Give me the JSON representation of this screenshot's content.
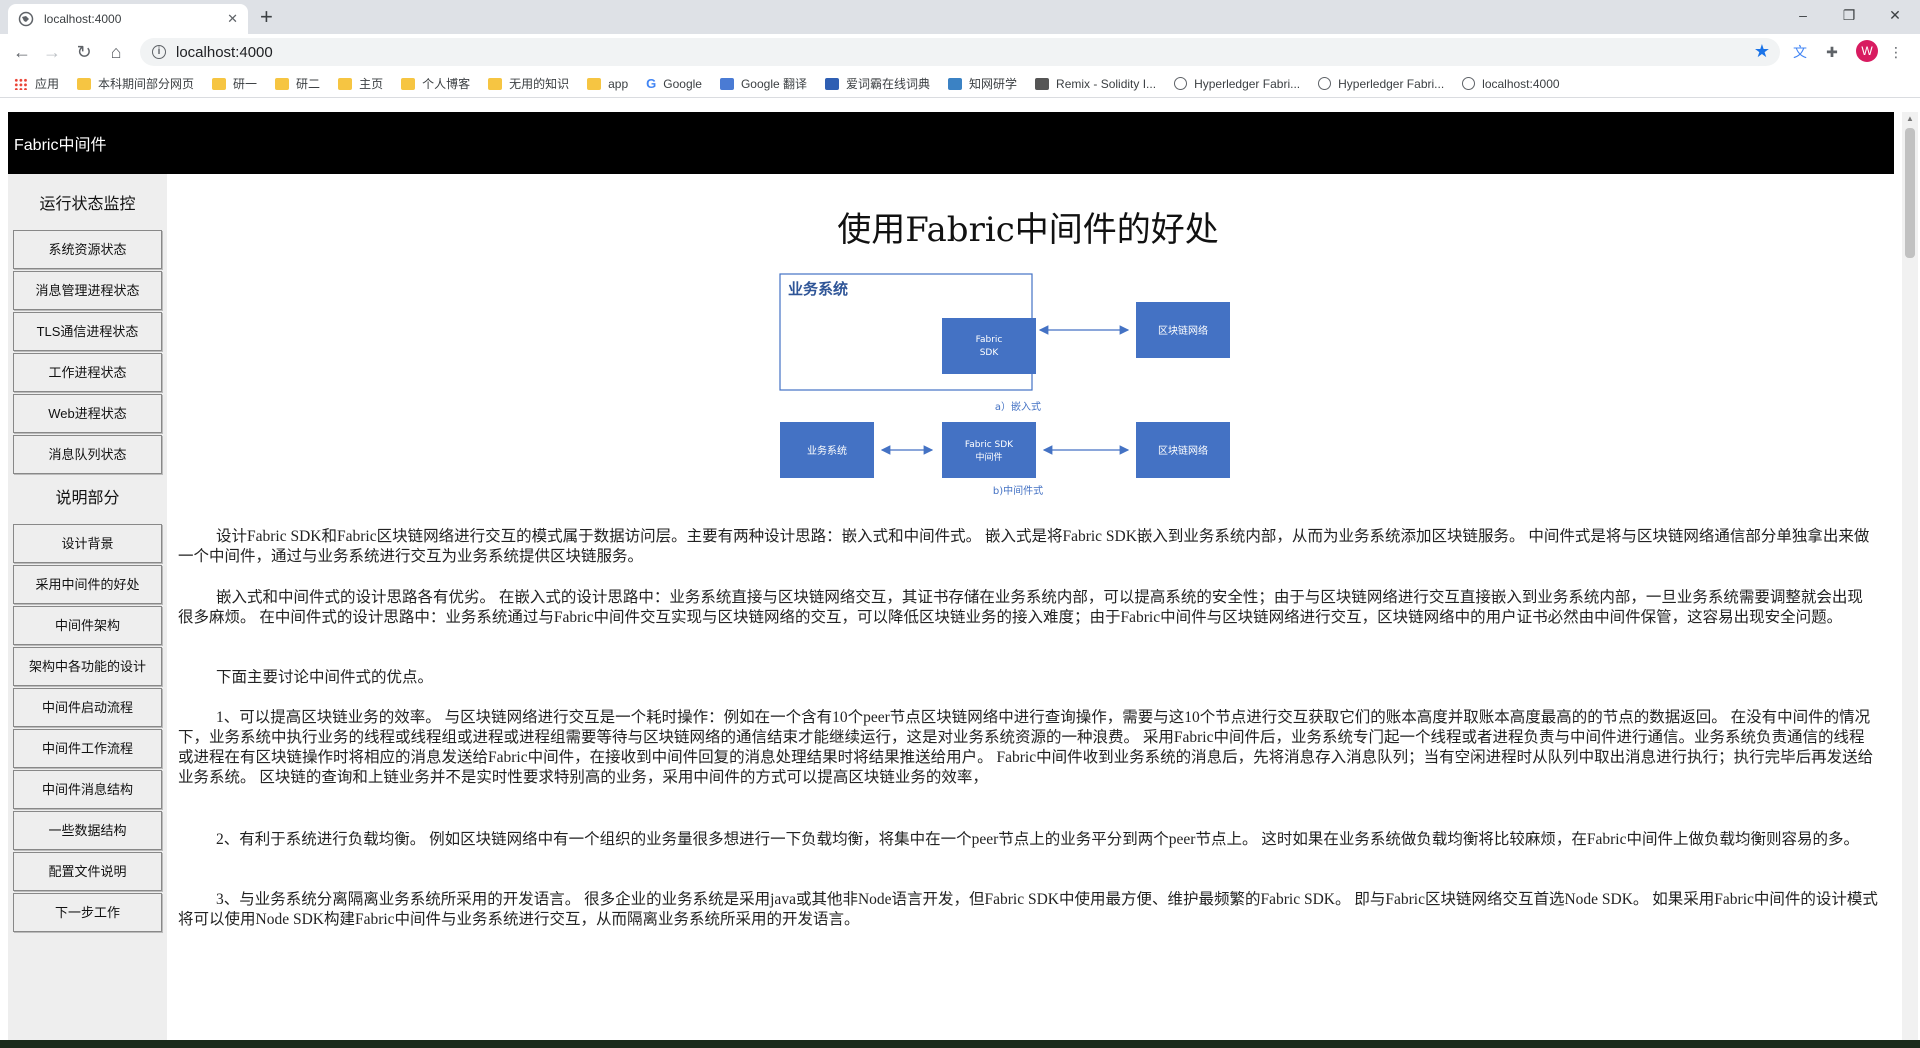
{
  "browser": {
    "tab_title": "localhost:4000",
    "tab_close": "✕",
    "new_tab": "+",
    "address": "localhost:4000",
    "window_controls": [
      "–",
      "❐",
      "✕"
    ],
    "avatar_letter": "W",
    "bookmarks": [
      {
        "label": "应用",
        "icon": "apps-icon"
      },
      {
        "label": "本科期间部分网页",
        "icon": "folder-icon"
      },
      {
        "label": "研一",
        "icon": "folder-icon"
      },
      {
        "label": "研二",
        "icon": "folder-icon"
      },
      {
        "label": "主页",
        "icon": "folder-icon"
      },
      {
        "label": "个人博客",
        "icon": "folder-icon"
      },
      {
        "label": "无用的知识",
        "icon": "folder-icon"
      },
      {
        "label": "app",
        "icon": "folder-icon"
      },
      {
        "label": "Google",
        "icon": "google-icon"
      },
      {
        "label": "Google 翻译",
        "icon": "translate-icon"
      },
      {
        "label": "爱词霸在线词典",
        "icon": "dictionary-icon"
      },
      {
        "label": "知网研学",
        "icon": "cnki-icon"
      },
      {
        "label": "Remix - Solidity I...",
        "icon": "remix-icon"
      },
      {
        "label": "Hyperledger Fabri...",
        "icon": "globe-icon"
      },
      {
        "label": "Hyperledger Fabri...",
        "icon": "globe-icon"
      },
      {
        "label": "localhost:4000",
        "icon": "globe-icon"
      }
    ]
  },
  "header": {
    "title": "Fabric中间件"
  },
  "sidebar": {
    "section1_title": "运行状态监控",
    "section1_items": [
      "系统资源状态",
      "消息管理进程状态",
      "TLS通信进程状态",
      "工作进程状态",
      "Web进程状态",
      "消息队列状态"
    ],
    "section2_title": "说明部分",
    "section2_items": [
      "设计背景",
      "采用中间件的好处",
      "中间件架构",
      "架构中各功能的设计",
      "中间件启动流程",
      "中间件工作流程",
      "中间件消息结构",
      "一些数据结构",
      "配置文件说明",
      "下一步工作"
    ]
  },
  "main": {
    "title": "使用Fabric中间件的好处",
    "diagram": {
      "business_system_title": "业务系统",
      "fabric_sdk_line1": "Fabric",
      "fabric_sdk_line2": "SDK",
      "blockchain_a": "区块链网络",
      "caption_a": "a）嵌入式",
      "business_system_b": "业务系统",
      "middleware_line1": "Fabric SDK",
      "middleware_line2": "中间件",
      "blockchain_b": "区块链网络",
      "caption_b": "b)中间件式",
      "box_color": "#4472c4"
    },
    "paragraphs": [
      "设计Fabric SDK和Fabric区块链网络进行交互的模式属于数据访问层。主要有两种设计思路：嵌入式和中间件式。 嵌入式是将Fabric SDK嵌入到业务系统内部，从而为业务系统添加区块链服务。 中间件式是将与区块链网络通信部分单独拿出来做一个中间件，通过与业务系统进行交互为业务系统提供区块链服务。",
      "嵌入式和中间件式的设计思路各有优劣。 在嵌入式的设计思路中：业务系统直接与区块链网络交互，其证书存储在业务系统内部，可以提高系统的安全性；由于与区块链网络进行交互直接嵌入到业务系统内部，一旦业务系统需要调整就会出现很多麻烦。 在中间件式的设计思路中：业务系统通过与Fabric中间件交互实现与区块链网络的交互，可以降低区块链业务的接入难度；由于Fabric中间件与区块链网络进行交互，区块链网络中的用户证书必然由中间件保管，这容易出现安全问题。",
      "下面主要讨论中间件式的优点。",
      "1、可以提高区块链业务的效率。 与区块链网络进行交互是一个耗时操作：例如在一个含有10个peer节点区块链网络中进行查询操作，需要与这10个节点进行交互获取它们的账本高度并取账本高度最高的的节点的数据返回。 在没有中间件的情况下，业务系统中执行业务的线程或线程组或进程或进程组需要等待与区块链网络的通信结束才能继续运行，这是对业务系统资源的一种浪费。 采用Fabric中间件后，业务系统专门起一个线程或者进程负责与中间件进行通信。业务系统负责通信的线程或进程在有区块链操作时将相应的消息发送给Fabric中间件，在接收到中间件回复的消息处理结果时将结果推送给用户。 Fabric中间件收到业务系统的消息后，先将消息存入消息队列；当有空闲进程时从队列中取出消息进行执行；执行完毕后再发送给业务系统。 区块链的查询和上链业务并不是实时性要求特别高的业务，采用中间件的方式可以提高区块链业务的效率，",
      "2、有利于系统进行负载均衡。 例如区块链网络中有一个组织的业务量很多想进行一下负载均衡，将集中在一个peer节点上的业务平分到两个peer节点上。 这时如果在业务系统做负载均衡将比较麻烦，在Fabric中间件上做负载均衡则容易的多。",
      "3、与业务系统分离隔离业务系统所采用的开发语言。 很多企业的业务系统是采用java或其他非Node语言开发，但Fabric SDK中使用最方便、维护最频繁的Fabric SDK。 即与Fabric区块链网络交互首选Node SDK。 如果采用Fabric中间件的设计模式将可以使用Node SDK构建Fabric中间件与业务系统进行交互，从而隔离业务系统所采用的开发语言。"
    ]
  }
}
